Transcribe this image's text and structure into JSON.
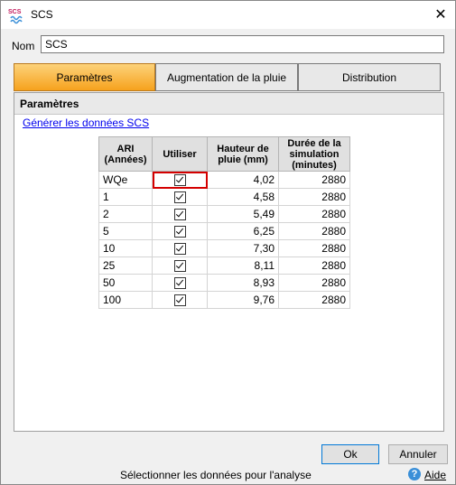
{
  "window": {
    "title": "SCS",
    "icon_text": "SCS"
  },
  "name_field": {
    "label": "Nom",
    "value": "SCS"
  },
  "tabs": [
    {
      "label": "Paramètres"
    },
    {
      "label": "Augmentation de la pluie"
    },
    {
      "label": "Distribution"
    }
  ],
  "section": {
    "title": "Paramètres",
    "link": "Générer les données SCS"
  },
  "table": {
    "headers": [
      "ARI\n(Années)",
      "Utiliser",
      "Hauteur de\npluie (mm)",
      "Durée de la\nsimulation\n(minutes)"
    ],
    "rows": [
      {
        "ari": "WQe",
        "use": true,
        "depth": "4,02",
        "duration": "2880"
      },
      {
        "ari": "1",
        "use": true,
        "depth": "4,58",
        "duration": "2880"
      },
      {
        "ari": "2",
        "use": true,
        "depth": "5,49",
        "duration": "2880"
      },
      {
        "ari": "5",
        "use": true,
        "depth": "6,25",
        "duration": "2880"
      },
      {
        "ari": "10",
        "use": true,
        "depth": "7,30",
        "duration": "2880"
      },
      {
        "ari": "25",
        "use": true,
        "depth": "8,11",
        "duration": "2880"
      },
      {
        "ari": "50",
        "use": true,
        "depth": "8,93",
        "duration": "2880"
      },
      {
        "ari": "100",
        "use": true,
        "depth": "9,76",
        "duration": "2880"
      }
    ]
  },
  "buttons": {
    "ok": "Ok",
    "cancel": "Annuler"
  },
  "status": {
    "text": "Sélectionner les données pour l'analyse",
    "help": "Aide"
  },
  "colors": {
    "active_tab": "#f6a21d",
    "selection": "#d40000",
    "link": "#0000ee"
  }
}
